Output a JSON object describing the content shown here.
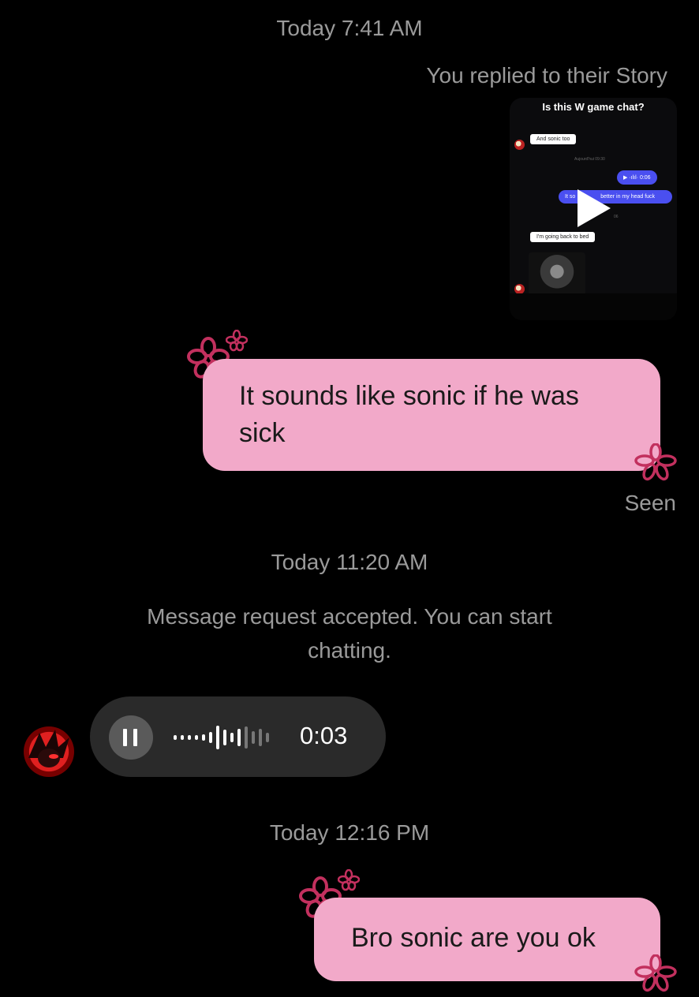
{
  "timestamps": {
    "first": "Today 7:41 AM",
    "second": "Today 11:20 AM",
    "third": "Today 12:16 PM"
  },
  "story_reply": {
    "label": "You replied to their Story",
    "preview": {
      "title": "Is this W game chat?",
      "msg_1": "And sonic too",
      "meta_1": "Aujourd'hui 09:30",
      "voice_dur": "0:06",
      "blue_msg_left": "It so",
      "blue_msg_right": "better in my head fuck",
      "meta_2": "06",
      "msg_2": "I'm going back to bed"
    }
  },
  "messages": {
    "reply_1": "It sounds like sonic if he was sick",
    "seen": "Seen",
    "system": "Message request accepted. You can start chatting.",
    "voice_duration": "0:03",
    "reply_2": "Bro sonic are you ok"
  },
  "icons": {
    "voice_pause": "pause-icon",
    "preview_play": "play-icon",
    "decor": "flower-icon"
  },
  "colors": {
    "bubble_pink": "#f2a9c9",
    "flower": "#c2305e",
    "voice_bubble": "#2a2a2a",
    "preview_blue": "#4a4ff0"
  }
}
